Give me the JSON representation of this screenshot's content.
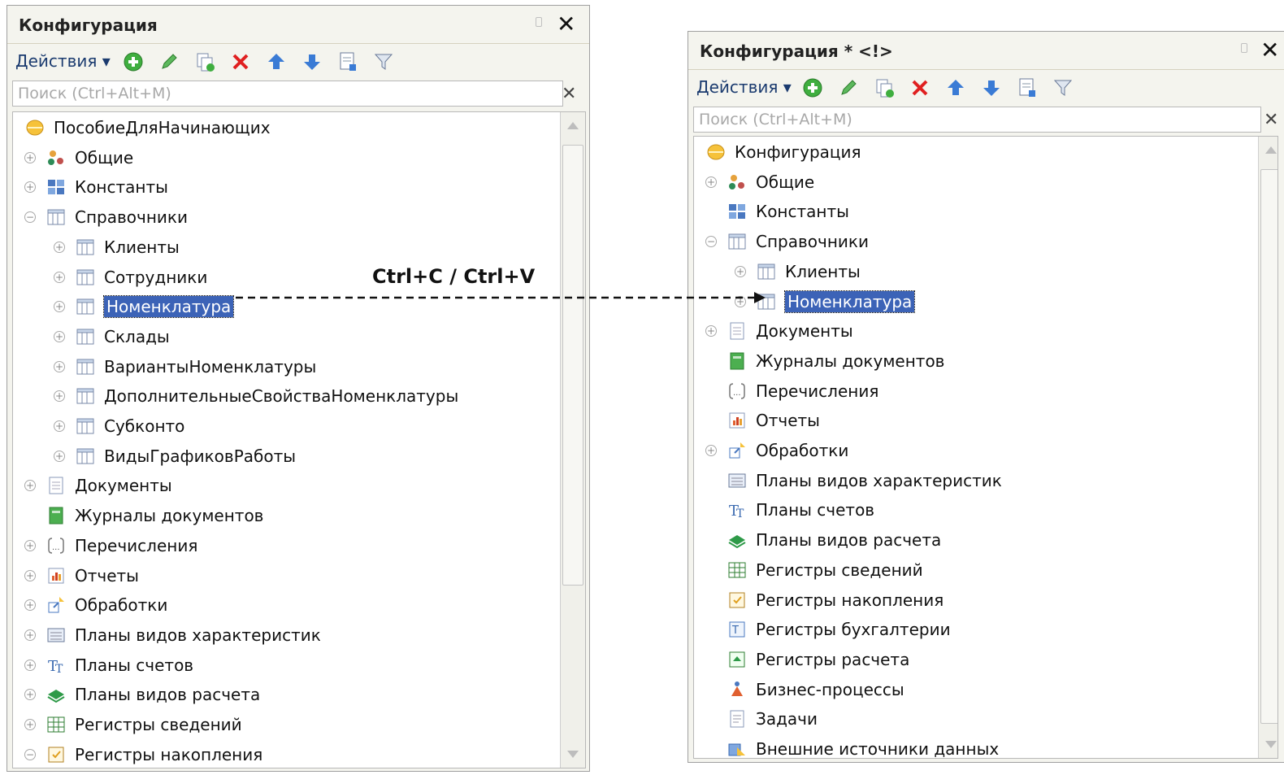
{
  "left_panel": {
    "title": "Конфигурация",
    "actions_label": "Действия ▾",
    "search_placeholder": "Поиск (Ctrl+Alt+M)",
    "tree": [
      {
        "label": "ПособиеДляНачинающих",
        "icon": "config-root-icon",
        "level": 0,
        "expander": "none"
      },
      {
        "label": "Общие",
        "icon": "common-icon",
        "level": 1,
        "expander": "plus"
      },
      {
        "label": "Константы",
        "icon": "constants-icon",
        "level": 1,
        "expander": "plus"
      },
      {
        "label": "Справочники",
        "icon": "catalog-icon",
        "level": 1,
        "expander": "minus"
      },
      {
        "label": "Клиенты",
        "icon": "catalog-icon",
        "level": 2,
        "expander": "plus"
      },
      {
        "label": "Сотрудники",
        "icon": "catalog-icon",
        "level": 2,
        "expander": "plus"
      },
      {
        "label": "Номенклатура",
        "icon": "catalog-icon",
        "level": 2,
        "expander": "plus",
        "selected": true
      },
      {
        "label": "Склады",
        "icon": "catalog-icon",
        "level": 2,
        "expander": "plus"
      },
      {
        "label": "ВариантыНоменклатуры",
        "icon": "catalog-icon",
        "level": 2,
        "expander": "plus"
      },
      {
        "label": "ДополнительныеСвойстваНоменклатуры",
        "icon": "catalog-icon",
        "level": 2,
        "expander": "plus"
      },
      {
        "label": "Субконто",
        "icon": "catalog-icon",
        "level": 2,
        "expander": "plus"
      },
      {
        "label": "ВидыГрафиковРаботы",
        "icon": "catalog-icon",
        "level": 2,
        "expander": "plus"
      },
      {
        "label": "Документы",
        "icon": "document-icon",
        "level": 1,
        "expander": "plus"
      },
      {
        "label": "Журналы документов",
        "icon": "journal-icon",
        "level": 1,
        "expander": "none"
      },
      {
        "label": "Перечисления",
        "icon": "enum-icon",
        "level": 1,
        "expander": "plus"
      },
      {
        "label": "Отчеты",
        "icon": "report-icon",
        "level": 1,
        "expander": "plus"
      },
      {
        "label": "Обработки",
        "icon": "dataprocessor-icon",
        "level": 1,
        "expander": "plus"
      },
      {
        "label": "Планы видов характеристик",
        "icon": "chart-of-characteristics-icon",
        "level": 1,
        "expander": "plus"
      },
      {
        "label": "Планы счетов",
        "icon": "chart-of-accounts-icon",
        "level": 1,
        "expander": "plus"
      },
      {
        "label": "Планы видов расчета",
        "icon": "chart-of-calc-icon",
        "level": 1,
        "expander": "plus"
      },
      {
        "label": "Регистры сведений",
        "icon": "info-register-icon",
        "level": 1,
        "expander": "plus"
      },
      {
        "label": "Регистры накопления",
        "icon": "accum-register-icon",
        "level": 1,
        "expander": "minus"
      }
    ]
  },
  "right_panel": {
    "title": "Конфигурация * <!>",
    "actions_label": "Действия ▾",
    "search_placeholder": "Поиск (Ctrl+Alt+M)",
    "tree": [
      {
        "label": "Конфигурация",
        "icon": "config-root-icon",
        "level": 0,
        "expander": "none"
      },
      {
        "label": "Общие",
        "icon": "common-icon",
        "level": 1,
        "expander": "plus"
      },
      {
        "label": "Константы",
        "icon": "constants-icon",
        "level": 1,
        "expander": "none"
      },
      {
        "label": "Справочники",
        "icon": "catalog-icon",
        "level": 1,
        "expander": "minus"
      },
      {
        "label": "Клиенты",
        "icon": "catalog-icon",
        "level": 2,
        "expander": "plus"
      },
      {
        "label": "Номенклатура",
        "icon": "catalog-icon",
        "level": 2,
        "expander": "plus",
        "selected": true
      },
      {
        "label": "Документы",
        "icon": "document-icon",
        "level": 1,
        "expander": "plus"
      },
      {
        "label": "Журналы документов",
        "icon": "journal-icon",
        "level": 1,
        "expander": "none"
      },
      {
        "label": "Перечисления",
        "icon": "enum-icon",
        "level": 1,
        "expander": "none"
      },
      {
        "label": "Отчеты",
        "icon": "report-icon",
        "level": 1,
        "expander": "none"
      },
      {
        "label": "Обработки",
        "icon": "dataprocessor-icon",
        "level": 1,
        "expander": "plus"
      },
      {
        "label": "Планы видов характеристик",
        "icon": "chart-of-characteristics-icon",
        "level": 1,
        "expander": "none"
      },
      {
        "label": "Планы счетов",
        "icon": "chart-of-accounts-icon",
        "level": 1,
        "expander": "none"
      },
      {
        "label": "Планы видов расчета",
        "icon": "chart-of-calc-icon",
        "level": 1,
        "expander": "none"
      },
      {
        "label": "Регистры сведений",
        "icon": "info-register-icon",
        "level": 1,
        "expander": "none"
      },
      {
        "label": "Регистры накопления",
        "icon": "accum-register-icon",
        "level": 1,
        "expander": "none"
      },
      {
        "label": "Регистры бухгалтерии",
        "icon": "accounting-register-icon",
        "level": 1,
        "expander": "none"
      },
      {
        "label": "Регистры расчета",
        "icon": "calc-register-icon",
        "level": 1,
        "expander": "none"
      },
      {
        "label": "Бизнес-процессы",
        "icon": "business-process-icon",
        "level": 1,
        "expander": "none"
      },
      {
        "label": "Задачи",
        "icon": "task-icon",
        "level": 1,
        "expander": "none"
      },
      {
        "label": "Внешние источники данных",
        "icon": "external-source-icon",
        "level": 1,
        "expander": "none"
      }
    ]
  },
  "annotation": {
    "text": "Ctrl+C / Ctrl+V"
  },
  "colors": {
    "selection": "#3c63b7",
    "panel": "#f4f4ee",
    "accent_green": "#3fae3f",
    "accent_red": "#e02020",
    "accent_blue": "#3a7bd5"
  }
}
